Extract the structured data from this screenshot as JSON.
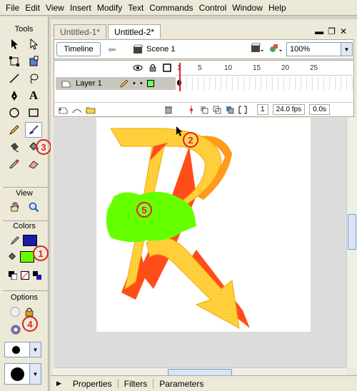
{
  "menu": [
    "File",
    "Edit",
    "View",
    "Insert",
    "Modify",
    "Text",
    "Commands",
    "Control",
    "Window",
    "Help"
  ],
  "tools_panel": {
    "header": "Tools",
    "view_label": "View",
    "colors_label": "Colors",
    "options_label": "Options",
    "text_tool_glyph": "A"
  },
  "tabs": [
    "Untitled-1*",
    "Untitled-2*"
  ],
  "toolbar": {
    "timeline_button": "Timeline",
    "scene_label": "Scene 1",
    "zoom_value": "100%"
  },
  "timeline": {
    "layer_name": "Layer 1",
    "frame_numbers": [
      "1",
      "5",
      "10",
      "15",
      "20",
      "25"
    ],
    "current_frame": "1",
    "fps": "24.0 fps",
    "time": "0.0s"
  },
  "callouts": [
    "1",
    "2",
    "3",
    "4",
    "5"
  ],
  "properties_tabs": [
    "Properties",
    "Filters",
    "Parameters"
  ],
  "colors": {
    "stroke": "#1a1aa6",
    "fill": "#66ff00",
    "callout": "#e02020",
    "letter_yellow": "#ffcc33",
    "letter_orange": "#ff4d1a"
  }
}
